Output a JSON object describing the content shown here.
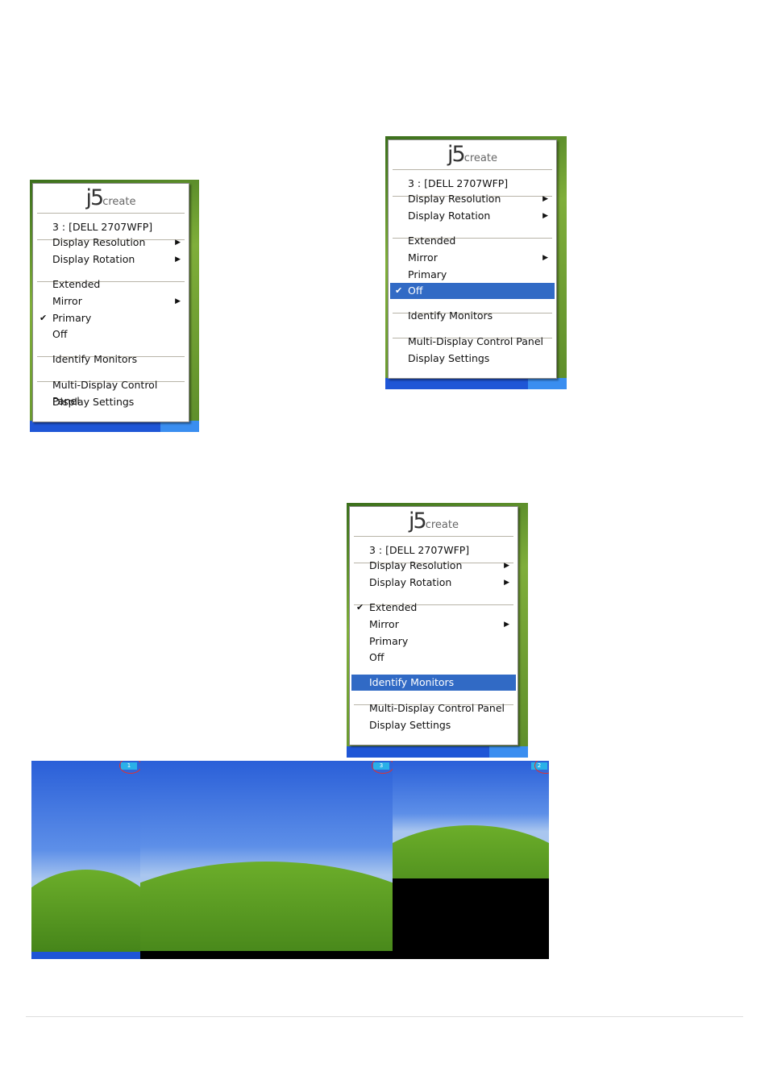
{
  "menus": [
    {
      "logo": "j5create",
      "header": "3 : [DELL 2707WFP]",
      "items": [
        {
          "label": "Display Resolution",
          "submenu": true
        },
        {
          "label": "Display Rotation",
          "submenu": true
        },
        {
          "label": "Extended"
        },
        {
          "label": "Mirror",
          "submenu": true
        },
        {
          "label": "Primary",
          "checked": true
        },
        {
          "label": "Off"
        },
        {
          "label": "Identify Monitors"
        },
        {
          "label": "Multi-Display Control Panel"
        },
        {
          "label": "Display Settings"
        }
      ]
    },
    {
      "logo": "j5create",
      "header": "3 : [DELL 2707WFP]",
      "items": [
        {
          "label": "Display Resolution",
          "submenu": true
        },
        {
          "label": "Display Rotation",
          "submenu": true
        },
        {
          "label": "Extended"
        },
        {
          "label": "Mirror",
          "submenu": true
        },
        {
          "label": "Primary"
        },
        {
          "label": "Off",
          "checked": true,
          "highlighted": true
        },
        {
          "label": "Identify Monitors"
        },
        {
          "label": "Multi-Display Control Panel"
        },
        {
          "label": "Display Settings"
        }
      ]
    },
    {
      "logo": "j5create",
      "header": "3 : [DELL 2707WFP]",
      "items": [
        {
          "label": "Display Resolution",
          "submenu": true
        },
        {
          "label": "Display Rotation",
          "submenu": true
        },
        {
          "label": "Extended",
          "checked": true
        },
        {
          "label": "Mirror",
          "submenu": true
        },
        {
          "label": "Primary"
        },
        {
          "label": "Off"
        },
        {
          "label": "Identify Monitors",
          "highlighted": true
        },
        {
          "label": "Multi-Display Control Panel"
        },
        {
          "label": "Display Settings"
        }
      ]
    }
  ],
  "desktop": {
    "monitor_labels": [
      "1",
      "3",
      "2"
    ]
  },
  "colors": {
    "highlight": "#316ac5",
    "taskbar": "#1f56d6"
  }
}
